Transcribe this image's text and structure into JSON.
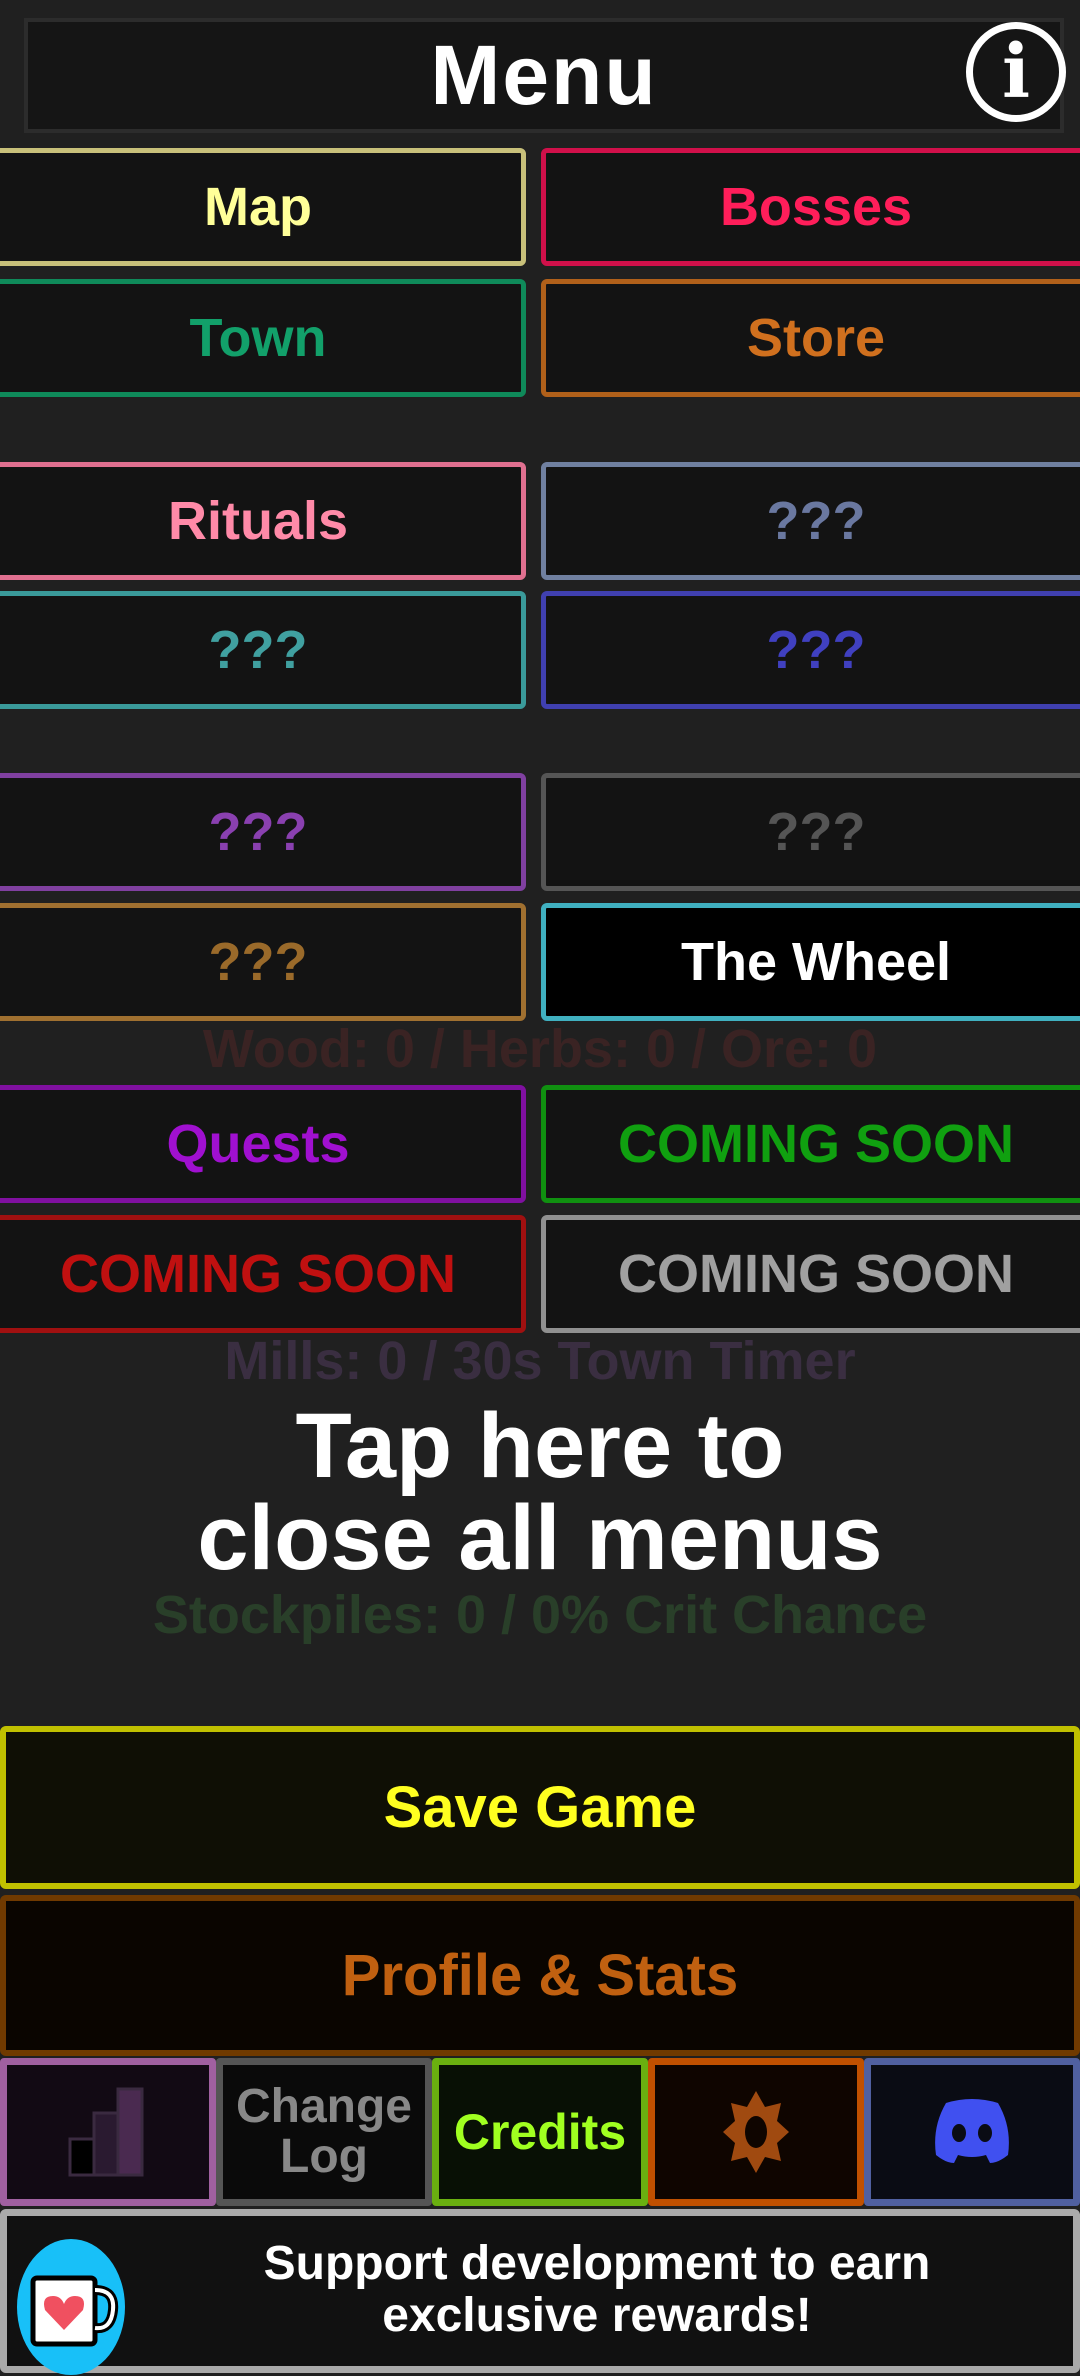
{
  "header": {
    "title": "Menu",
    "info_icon": "info-icon"
  },
  "menu": [
    {
      "label": "Map",
      "border": "#c8c07a",
      "color": "#ffff99"
    },
    {
      "label": "Bosses",
      "border": "#d0104a",
      "color": "#ff1e5a"
    },
    {
      "label": "Town",
      "border": "#0f8a5a",
      "color": "#12a06a"
    },
    {
      "label": "Store",
      "border": "#b0601a",
      "color": "#d0701e"
    },
    {
      "label": "Rituals",
      "border": "#e07090",
      "color": "#ff8aa8"
    },
    {
      "label": "???",
      "border": "#7080a0",
      "color": "#6a78a0"
    },
    {
      "label": "???",
      "border": "#3a9a9a",
      "color": "#40a0a0"
    },
    {
      "label": "???",
      "border": "#4040b0",
      "color": "#4040c0"
    },
    {
      "label": "???",
      "border": "#8040a0",
      "color": "#8a40b0"
    },
    {
      "label": "???",
      "border": "#555555",
      "color": "#555555"
    },
    {
      "label": "???",
      "border": "#a07030",
      "color": "#9a6a2a"
    },
    {
      "label": "The Wheel",
      "border": "#40b0c0",
      "color": "#ffffff"
    },
    {
      "label": "Quests",
      "border": "#8010a0",
      "color": "#a010d0"
    },
    {
      "label": "COMING SOON",
      "border": "#109010",
      "color": "#10a010"
    },
    {
      "label": "COMING SOON",
      "border": "#a01010",
      "color": "#c01010"
    },
    {
      "label": "COMING SOON",
      "border": "#909090",
      "color": "#a0a0a0"
    }
  ],
  "background": {
    "resources": "Wood: 0 / Herbs: 0 / Ore: 0",
    "mills": "Mills: 0 / 30s Town Timer",
    "stockpiles": "Stockpiles: 0 / 0% Crit Chance"
  },
  "overlay": {
    "close_line1": "Tap here to",
    "close_line2": "close all menus"
  },
  "save_label": "Save Game",
  "profile_label": "Profile & Stats",
  "bottom": {
    "leaderboard_icon": "leaderboard-icon",
    "changelog_line1": "Change",
    "changelog_line2": "Log",
    "credits": "Credits",
    "settings_icon": "gear-icon",
    "discord_icon": "discord-icon"
  },
  "support": {
    "line1": "Support development to earn",
    "line2": "exclusive rewards!",
    "icon": "coffee-heart-icon"
  }
}
